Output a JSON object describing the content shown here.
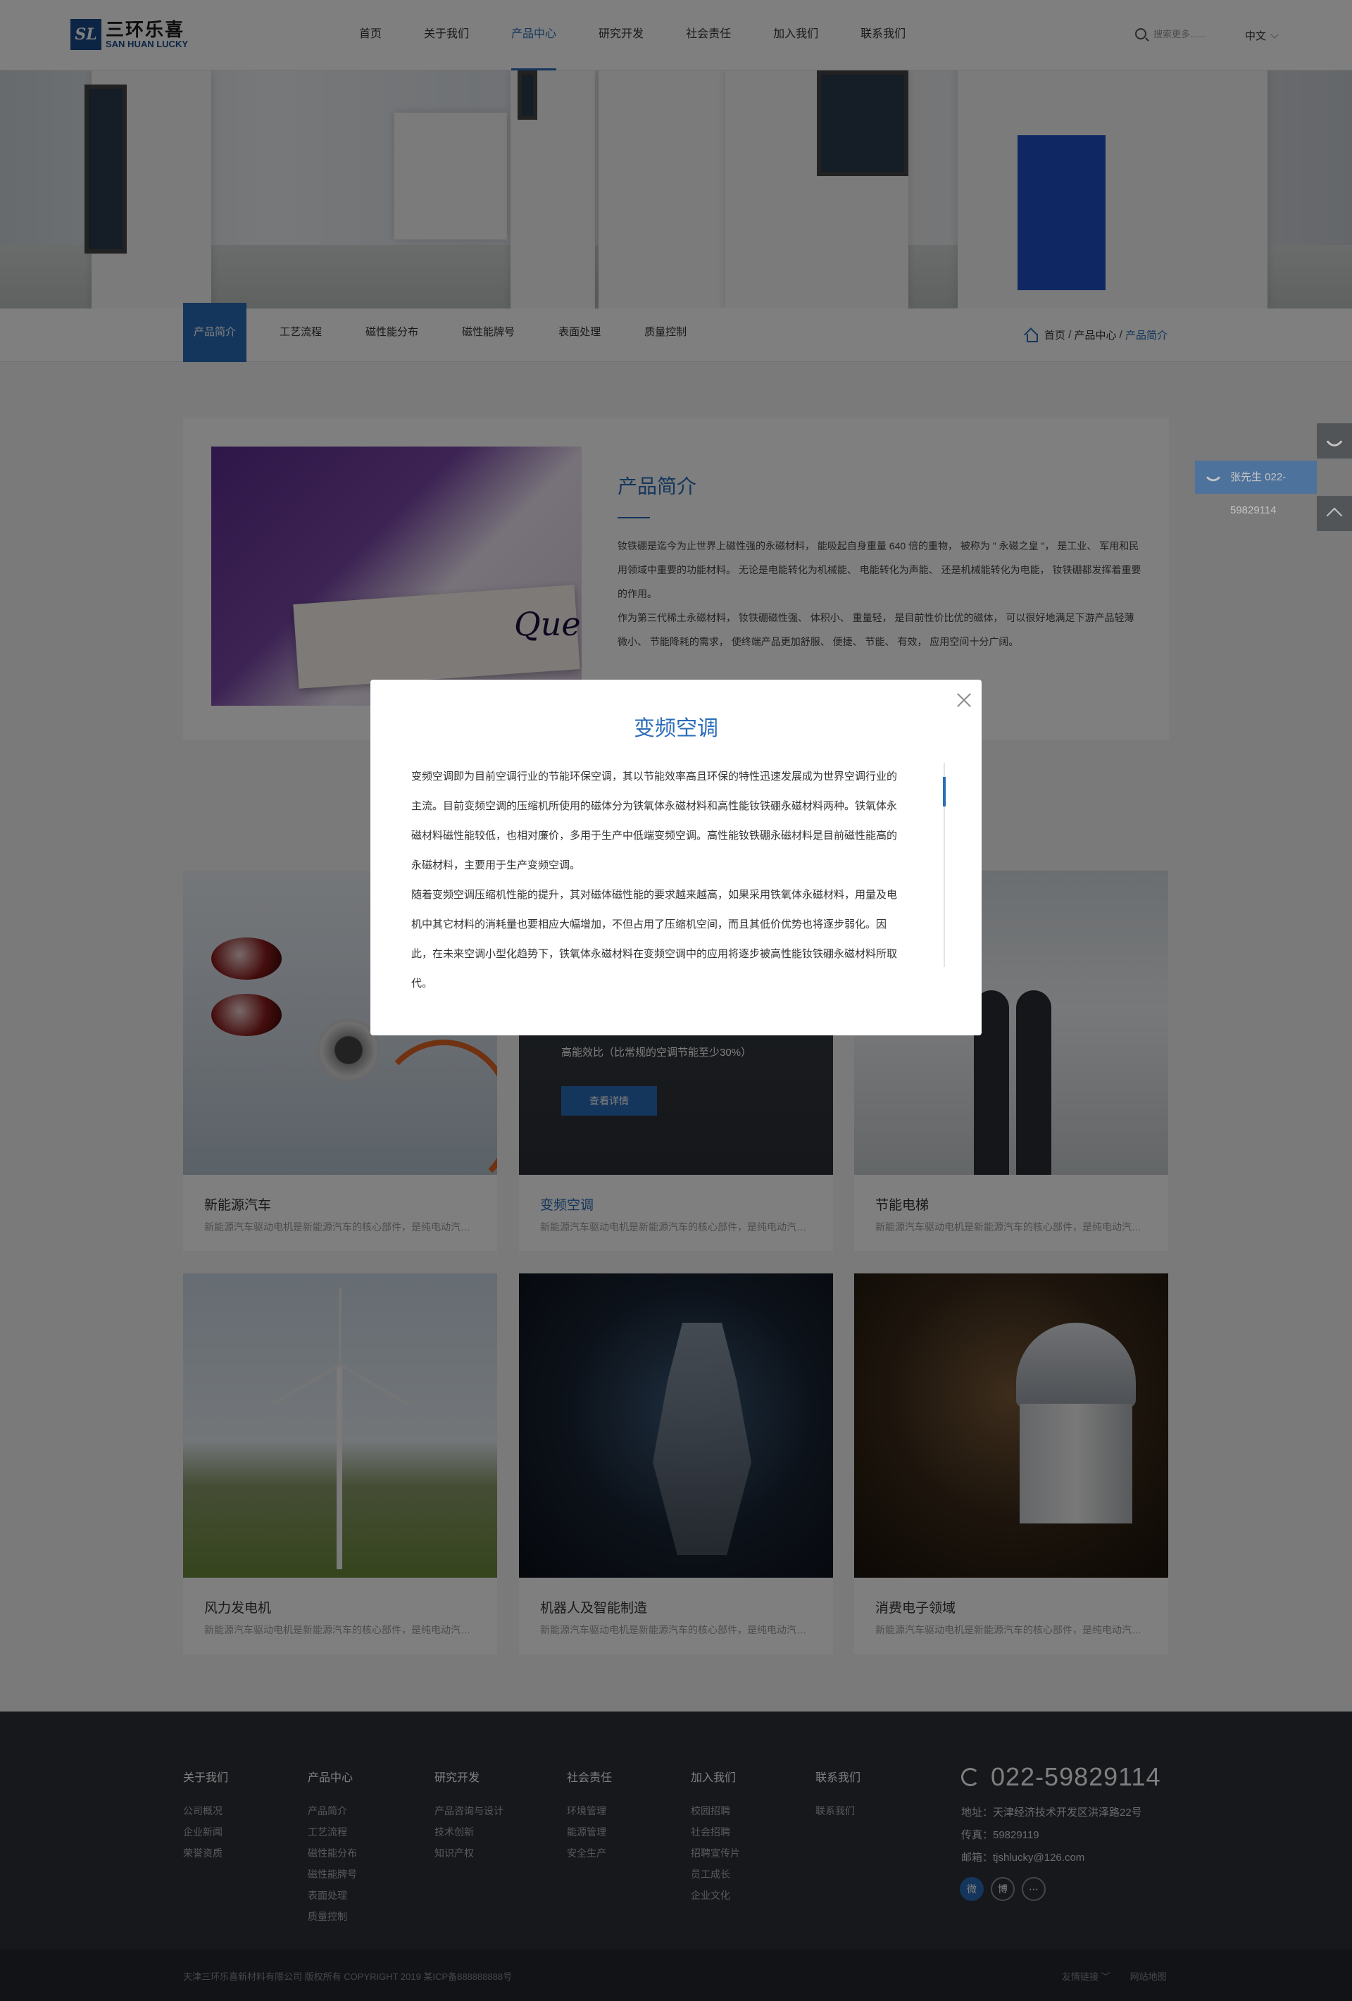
{
  "header": {
    "logo_mark": "SL",
    "logo_cn": "三环乐喜",
    "logo_en": "SAN HUAN LUCKY",
    "nav": [
      "首页",
      "关于我们",
      "产品中心",
      "研究开发",
      "社会责任",
      "加入我们",
      "联系我们"
    ],
    "search_placeholder": "搜索更多......",
    "lang": "中文"
  },
  "subnav": {
    "items": [
      "产品简介",
      "工艺流程",
      "磁性能分布",
      "磁性能牌号",
      "表面处理",
      "质量控制"
    ],
    "breadcrumb": [
      "首页",
      "产品中心",
      "产品简介"
    ]
  },
  "intro": {
    "title": "产品简介",
    "image_word": "Queen",
    "paragraphs": [
      "钕铁硼是迄今为止世界上磁性强的永磁材料， 能吸起自身重量 640 倍的重物， 被称为 \" 永磁之皇 \"， 是工业、 军用和民用领域中重要的功能材料。 无论是电能转化为机械能、 电能转化为声能、 还是机械能转化为电能， 钕铁硼都发挥着重要的作用。",
      "作为第三代稀土永磁材料， 钕铁硼磁性强、 体积小、 重量轻， 是目前性价比优的磁体， 可以很好地满足下游产品轻薄微小、 节能降耗的需求， 使终端产品更加舒服、 便捷、 节能、 有效， 应用空间十分广阔。"
    ]
  },
  "cards": [
    {
      "title": "新能源汽车",
      "desc": "新能源汽车驱动电机是新能源汽车的核心部件，是纯电动汽车行驶中的主要执行结构"
    },
    {
      "title": "变频空调",
      "desc": "新能源汽车驱动电机是新能源汽车的核心部件，是纯电动汽车行驶中的主要执行结构",
      "overlay_text": "高能效比（比常规的空调节能至少30%）",
      "overlay_button": "查看详情"
    },
    {
      "title": "节能电梯",
      "desc": "新能源汽车驱动电机是新能源汽车的核心部件，是纯电动汽车行驶中的主要执行结构"
    },
    {
      "title": "风力发电机",
      "desc": "新能源汽车驱动电机是新能源汽车的核心部件，是纯电动汽车行驶中的主要执行结构"
    },
    {
      "title": "机器人及智能制造",
      "desc": "新能源汽车驱动电机是新能源汽车的核心部件，是纯电动汽车行驶中的主要执行结构"
    },
    {
      "title": "消费电子领域",
      "desc": "新能源汽车驱动电机是新能源汽车的核心部件，是纯电动汽车行驶中的主要执行结构"
    }
  ],
  "modal": {
    "title": "变频空调",
    "paragraphs": [
      "变频空调即为目前空调行业的节能环保空调，其以节能效率高且环保的特性迅速发展成为世界空调行业的主流。目前变频空调的压缩机所使用的磁体分为铁氧体永磁材料和高性能钕铁硼永磁材料两种。铁氧体永磁材料磁性能较低，也相对廉价，多用于生产中低端变频空调。高性能钕铁硼永磁材料是目前磁性能高的永磁材料，主要用于生产变频空调。",
      "随着变频空调压缩机性能的提升，其对磁体磁性能的要求越来越高，如果采用铁氧体永磁材料，用量及电机中其它材料的消耗量也要相应大幅增加，不但占用了压缩机空间，而且其低价优势也将逐步弱化。因此，在未来空调小型化趋势下，铁氧体永磁材料在变频空调中的应用将逐步被高性能钕铁硼永磁材料所取代。"
    ]
  },
  "side": {
    "call_text": "张先生 022-59829114"
  },
  "footer": {
    "columns": [
      {
        "head": "关于我们",
        "links": [
          "公司概况",
          "企业新闻",
          "荣誉资质"
        ]
      },
      {
        "head": "产品中心",
        "links": [
          "产品简介",
          "工艺流程",
          "磁性能分布",
          "磁性能牌号",
          "表面处理",
          "质量控制"
        ]
      },
      {
        "head": "研究开发",
        "links": [
          "产品咨询与设计",
          "技术创新",
          "知识产权"
        ]
      },
      {
        "head": "社会责任",
        "links": [
          "环境管理",
          "能源管理",
          "安全生产"
        ]
      },
      {
        "head": "加入我们",
        "links": [
          "校园招聘",
          "社会招聘",
          "招聘宣传片",
          "员工成长",
          "企业文化"
        ]
      },
      {
        "head": "联系我们",
        "links": [
          "联系我们"
        ]
      }
    ],
    "phone": "022-59829114",
    "address": "地址：天津经济技术开发区洪泽路22号",
    "fax": "传真：59829119",
    "email": "邮箱：tjshlucky@126.com",
    "social": [
      "微",
      "博",
      "⋯"
    ],
    "copyright": "天津三环乐喜新材料有限公司 版权所有 COPYRIGHT 2019  某ICP备888888888号",
    "bottom_links": [
      "友情链接 ﹀",
      "网站地图"
    ]
  }
}
